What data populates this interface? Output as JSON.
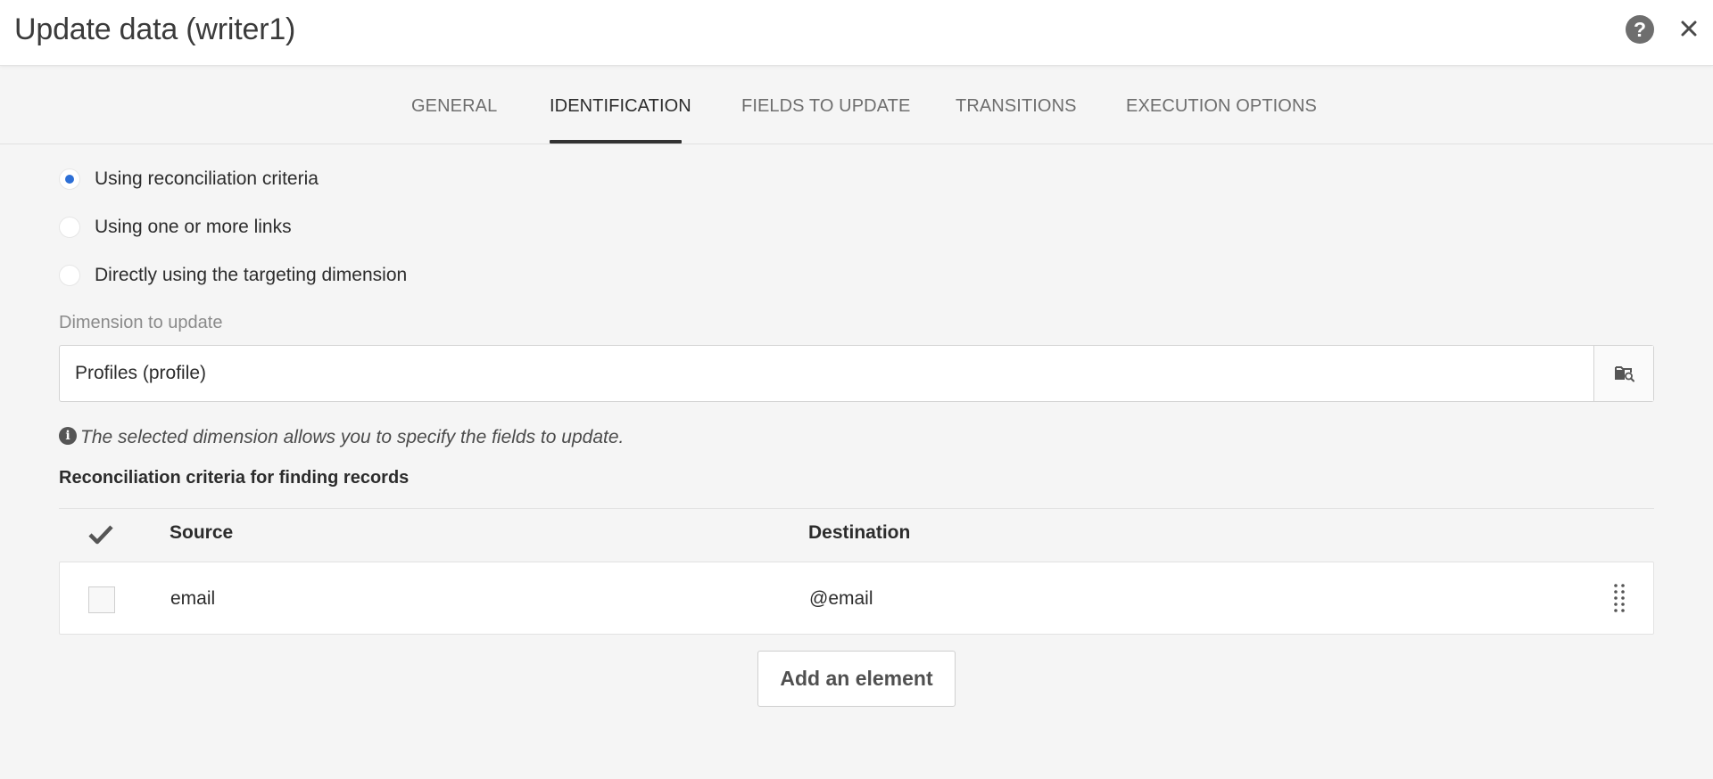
{
  "header": {
    "title": "Update data (writer1)"
  },
  "tabs": [
    {
      "label": "GENERAL"
    },
    {
      "label": "IDENTIFICATION"
    },
    {
      "label": "FIELDS TO UPDATE"
    },
    {
      "label": "TRANSITIONS"
    },
    {
      "label": "EXECUTION OPTIONS"
    }
  ],
  "active_tab": "IDENTIFICATION",
  "identification": {
    "options": [
      {
        "label": "Using reconciliation criteria",
        "checked": true
      },
      {
        "label": "Using one or more links",
        "checked": false
      },
      {
        "label": "Directly using the targeting dimension",
        "checked": false
      }
    ],
    "dimension_label": "Dimension to update",
    "dimension_value": "Profiles (profile)",
    "info_text": "The selected dimension allows you to specify the fields to update.",
    "section_title": "Reconciliation criteria for finding records"
  },
  "table": {
    "columns": [
      "Source",
      "Destination"
    ],
    "rows": [
      {
        "source": "email",
        "destination": "@email",
        "checked": false
      }
    ]
  },
  "add_button_label": "Add an element",
  "colors": {
    "accent": "#2d6fd6",
    "background": "#f5f5f5",
    "header_bg": "#ffffff"
  }
}
